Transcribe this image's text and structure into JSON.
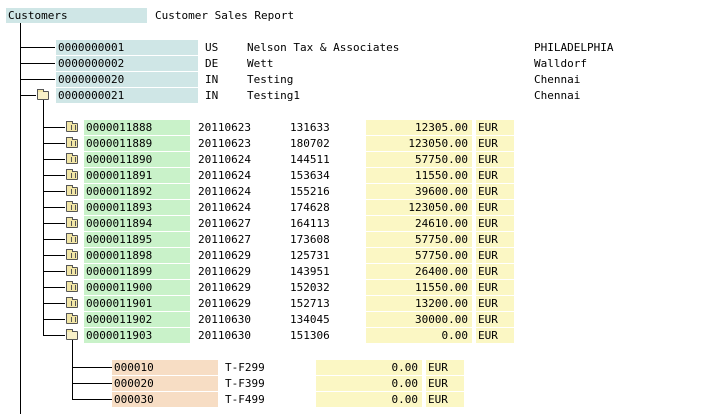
{
  "header": {
    "column_title": "Customers",
    "report_title": "Customer Sales Report"
  },
  "colors": {
    "key_cyan": "#cfe6e6",
    "key_green": "#c9f2c9",
    "key_orange": "#f7ddc4",
    "amount_yellow": "#fbf7c4",
    "white_cell": "#ffffff",
    "grid_bg": "#f0f0f0"
  },
  "customers": [
    {
      "id": "0000000001",
      "country": "US",
      "name": "Nelson Tax & Associates",
      "city": "PHILADELPHIA"
    },
    {
      "id": "0000000002",
      "country": "DE",
      "name": "Wett",
      "city": "Walldorf"
    },
    {
      "id": "0000000020",
      "country": "IN",
      "name": "Testing",
      "city": "Chennai"
    },
    {
      "id": "0000000021",
      "country": "IN",
      "name": "Testing1",
      "city": "Chennai",
      "expanded": true
    }
  ],
  "orders": [
    {
      "order": "0000011888",
      "date": "20110623",
      "num": "131633",
      "amount": "12305.00",
      "currency": "EUR"
    },
    {
      "order": "0000011889",
      "date": "20110623",
      "num": "180702",
      "amount": "123050.00",
      "currency": "EUR"
    },
    {
      "order": "0000011890",
      "date": "20110624",
      "num": "144511",
      "amount": "57750.00",
      "currency": "EUR"
    },
    {
      "order": "0000011891",
      "date": "20110624",
      "num": "153634",
      "amount": "11550.00",
      "currency": "EUR"
    },
    {
      "order": "0000011892",
      "date": "20110624",
      "num": "155216",
      "amount": "39600.00",
      "currency": "EUR"
    },
    {
      "order": "0000011893",
      "date": "20110624",
      "num": "174628",
      "amount": "123050.00",
      "currency": "EUR"
    },
    {
      "order": "0000011894",
      "date": "20110627",
      "num": "164113",
      "amount": "24610.00",
      "currency": "EUR"
    },
    {
      "order": "0000011895",
      "date": "20110627",
      "num": "173608",
      "amount": "57750.00",
      "currency": "EUR"
    },
    {
      "order": "0000011898",
      "date": "20110629",
      "num": "125731",
      "amount": "57750.00",
      "currency": "EUR"
    },
    {
      "order": "0000011899",
      "date": "20110629",
      "num": "143951",
      "amount": "26400.00",
      "currency": "EUR"
    },
    {
      "order": "0000011900",
      "date": "20110629",
      "num": "152032",
      "amount": "11550.00",
      "currency": "EUR"
    },
    {
      "order": "0000011901",
      "date": "20110629",
      "num": "152713",
      "amount": "13200.00",
      "currency": "EUR"
    },
    {
      "order": "0000011902",
      "date": "20110630",
      "num": "134045",
      "amount": "30000.00",
      "currency": "EUR"
    },
    {
      "order": "0000011903",
      "date": "20110630",
      "num": "151306",
      "amount": "0.00",
      "currency": "EUR",
      "expanded": true
    }
  ],
  "items": [
    {
      "item": "000010",
      "material": "T-F299",
      "amount": "0.00",
      "currency": "EUR"
    },
    {
      "item": "000020",
      "material": "T-F399",
      "amount": "0.00",
      "currency": "EUR"
    },
    {
      "item": "000030",
      "material": "T-F499",
      "amount": "0.00",
      "currency": "EUR"
    }
  ]
}
